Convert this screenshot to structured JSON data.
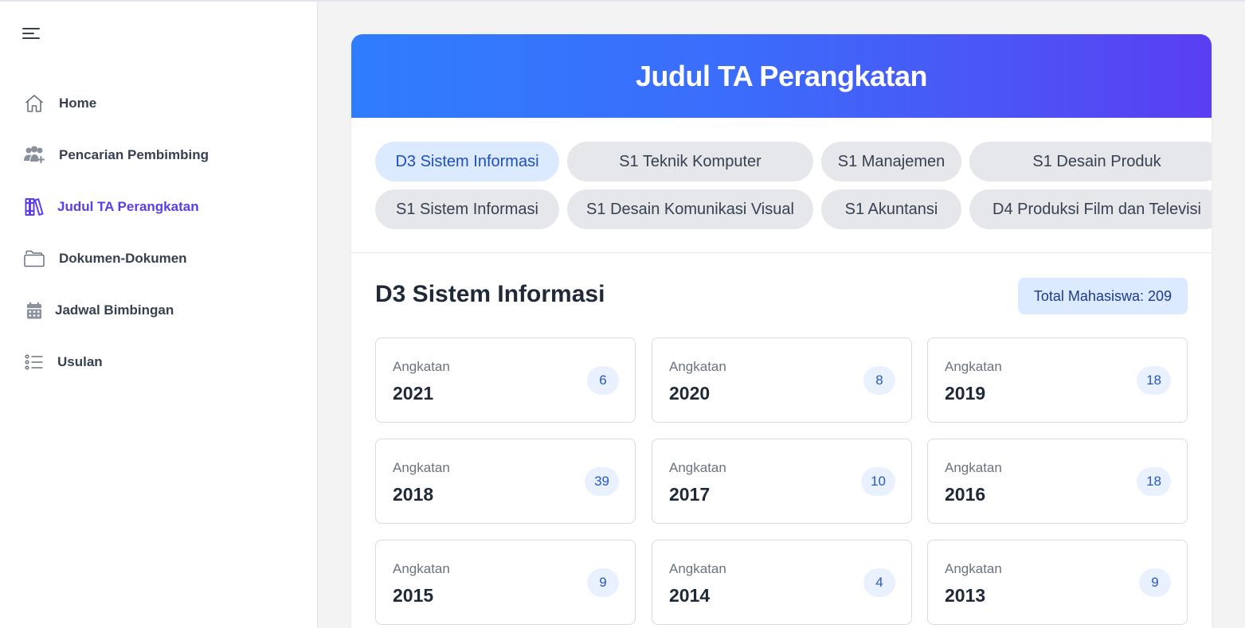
{
  "sidebar": {
    "items": [
      {
        "label": "Home",
        "icon": "home-icon"
      },
      {
        "label": "Pencarian Pembimbing",
        "icon": "users-plus-icon"
      },
      {
        "label": "Judul TA Perangkatan",
        "icon": "books-icon",
        "active": true
      },
      {
        "label": "Dokumen-Dokumen",
        "icon": "folders-icon"
      },
      {
        "label": "Jadwal Bimbingan",
        "icon": "calendar-icon"
      },
      {
        "label": "Usulan",
        "icon": "list-icon"
      }
    ]
  },
  "main": {
    "title": "Judul TA Perangkatan",
    "tabs": [
      {
        "label": "D3 Sistem Informasi",
        "active": true
      },
      {
        "label": "S1 Teknik Komputer"
      },
      {
        "label": "S1 Manajemen"
      },
      {
        "label": "S1 Desain Produk"
      },
      {
        "label": "S1 Sistem Informasi"
      },
      {
        "label": "S1 Desain Komunikasi Visual"
      },
      {
        "label": "S1 Akuntansi"
      },
      {
        "label": "D4 Produksi Film dan Televisi"
      }
    ],
    "section_title": "D3 Sistem Informasi",
    "total_badge": "Total Mahasiswa: 209",
    "years": [
      {
        "caption": "Angkatan",
        "year": "2021",
        "count": "6"
      },
      {
        "caption": "Angkatan",
        "year": "2020",
        "count": "8"
      },
      {
        "caption": "Angkatan",
        "year": "2019",
        "count": "18"
      },
      {
        "caption": "Angkatan",
        "year": "2018",
        "count": "39"
      },
      {
        "caption": "Angkatan",
        "year": "2017",
        "count": "10"
      },
      {
        "caption": "Angkatan",
        "year": "2016",
        "count": "18"
      },
      {
        "caption": "Angkatan",
        "year": "2015",
        "count": "9"
      },
      {
        "caption": "Angkatan",
        "year": "2014",
        "count": "4"
      },
      {
        "caption": "Angkatan",
        "year": "2013",
        "count": "9"
      }
    ]
  },
  "colors": {
    "accent": "#5b3ded",
    "header_gradient_start": "#2f7dfd",
    "header_gradient_end": "#5a3ef3",
    "badge_bg": "#dbeafe"
  }
}
